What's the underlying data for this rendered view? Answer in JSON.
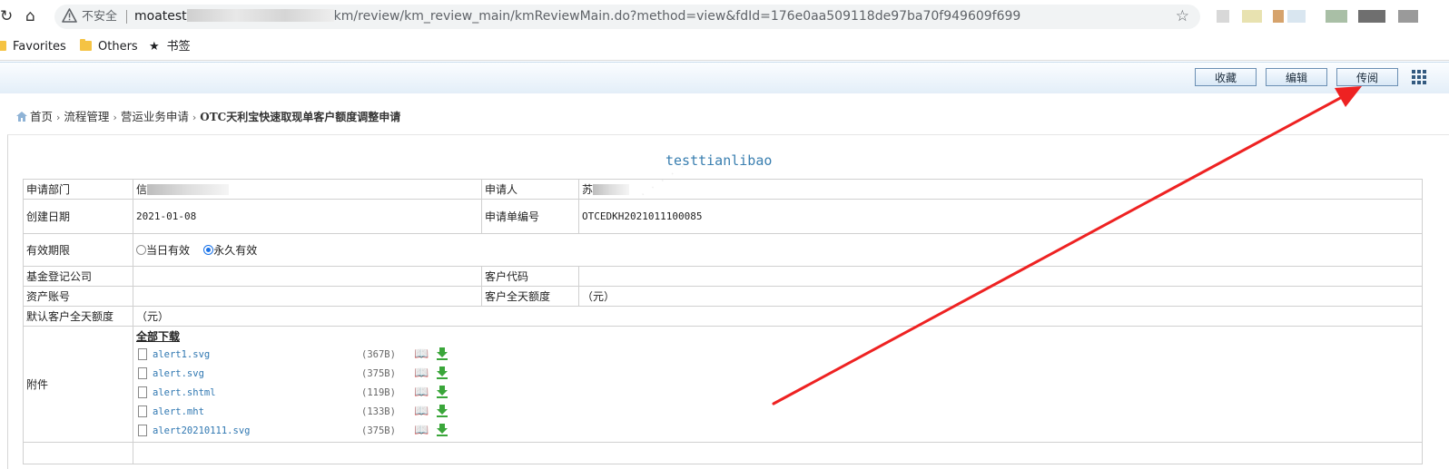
{
  "browser": {
    "insecure_label": "不安全",
    "url_host": "moatest",
    "url_path": "km/review/km_review_main/kmReviewMain.do?method=view&fdId=176e0aa509118de97ba70f949609f699",
    "bookmarks": [
      "Favorites",
      "Others",
      "书签"
    ]
  },
  "toolbar": {
    "buttons": [
      "收藏",
      "编辑",
      "传阅"
    ]
  },
  "breadcrumb": [
    "首页",
    "流程管理",
    "营运业务申请",
    "OTC天利宝快速取现单客户额度调整申请"
  ],
  "document": {
    "title": "testtianlibao",
    "labels": {
      "dept": "申请部门",
      "applicant": "申请人",
      "created": "创建日期",
      "form_no": "申请单编号",
      "validity": "有效期限",
      "fund_company": "基金登记公司",
      "customer_code": "客户代码",
      "asset_account": "资产账号",
      "daily_limit": "客户全天额度",
      "default_limit": "默认客户全天额度",
      "attachment": "附件"
    },
    "values": {
      "dept": "信",
      "applicant": "苏",
      "created": "2021-01-08",
      "form_no": "OTCEDKH2021011100085",
      "daily_limit": "（元）",
      "default_limit": "（元）"
    },
    "validity_options": [
      "当日有效",
      "永久有效"
    ],
    "validity_selected": "永久有效",
    "download_all": "全部下载",
    "attachments": [
      {
        "name": "alert1.svg",
        "size": "(367B)"
      },
      {
        "name": "alert.svg",
        "size": "(375B)"
      },
      {
        "name": "alert.shtml",
        "size": "(119B)"
      },
      {
        "name": "alert.mht",
        "size": "(133B)"
      },
      {
        "name": "alert20210111.svg",
        "size": "(375B)"
      }
    ]
  },
  "colors": {
    "annotation_arrow": "#ee2222",
    "title_blue": "#3a7fb0",
    "link_blue": "#2f77b1"
  }
}
